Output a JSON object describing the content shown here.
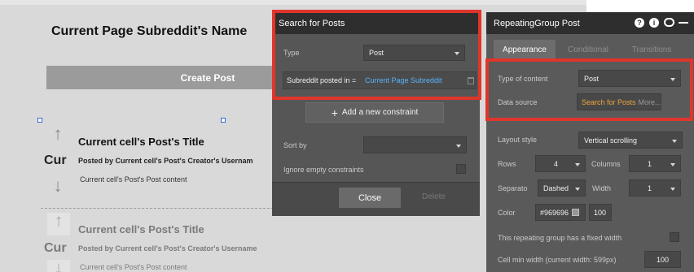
{
  "canvas": {
    "page_title": "Current Page Subreddit's Name",
    "create_post_label": "Create Post",
    "cells": [
      {
        "cur_label": "Cur",
        "title": "Current cell's Post's Title",
        "creator": "Posted by Current cell's Post's Creator's Usernam",
        "content": "Current cell's Post's Post content"
      },
      {
        "cur_label": "Cur",
        "title": "Current cell's Post's Title",
        "creator": "Posted by Current cell's Post's Creator's Username",
        "content": "Current cell's Post's Post content"
      }
    ]
  },
  "search_popup": {
    "title": "Search for Posts",
    "type_label": "Type",
    "type_value": "Post",
    "constraint_field": "Subreddit posted in =",
    "constraint_value": "Current Page Subreddit",
    "add_constraint_label": "Add a new constraint",
    "sort_by_label": "Sort by",
    "sort_by_value": "",
    "ignore_empty_label": "Ignore empty constraints",
    "close_label": "Close",
    "delete_label": "Delete"
  },
  "rg_popup": {
    "title": "RepeatingGroup Post",
    "tabs": [
      {
        "label": "Appearance",
        "active": true
      },
      {
        "label": "Conditional",
        "active": false
      },
      {
        "label": "Transitions",
        "active": false
      }
    ],
    "type_of_content_label": "Type of content",
    "type_of_content_value": "Post",
    "data_source_label": "Data source",
    "data_source_value": "Search for Posts",
    "data_source_more": "More...",
    "layout_style_label": "Layout style",
    "layout_style_value": "Vertical scrolling",
    "rows_label": "Rows",
    "rows_value": "4",
    "columns_label": "Columns",
    "columns_value": "1",
    "separator_label": "Separato",
    "separator_value": "Dashed",
    "width_label": "Width",
    "width_value": "1",
    "color_label": "Color",
    "color_value": "#969696",
    "color_opacity": "100",
    "fixed_width_label": "This repeating group has a fixed width",
    "cell_min_width_label": "Cell min width (current width: 599px)",
    "cell_min_width_value": "100"
  },
  "colors": {
    "highlight": "#e0352b",
    "link_blue": "#58b4ff",
    "source_orange": "#f0a53a",
    "separator_color": "#969696"
  }
}
